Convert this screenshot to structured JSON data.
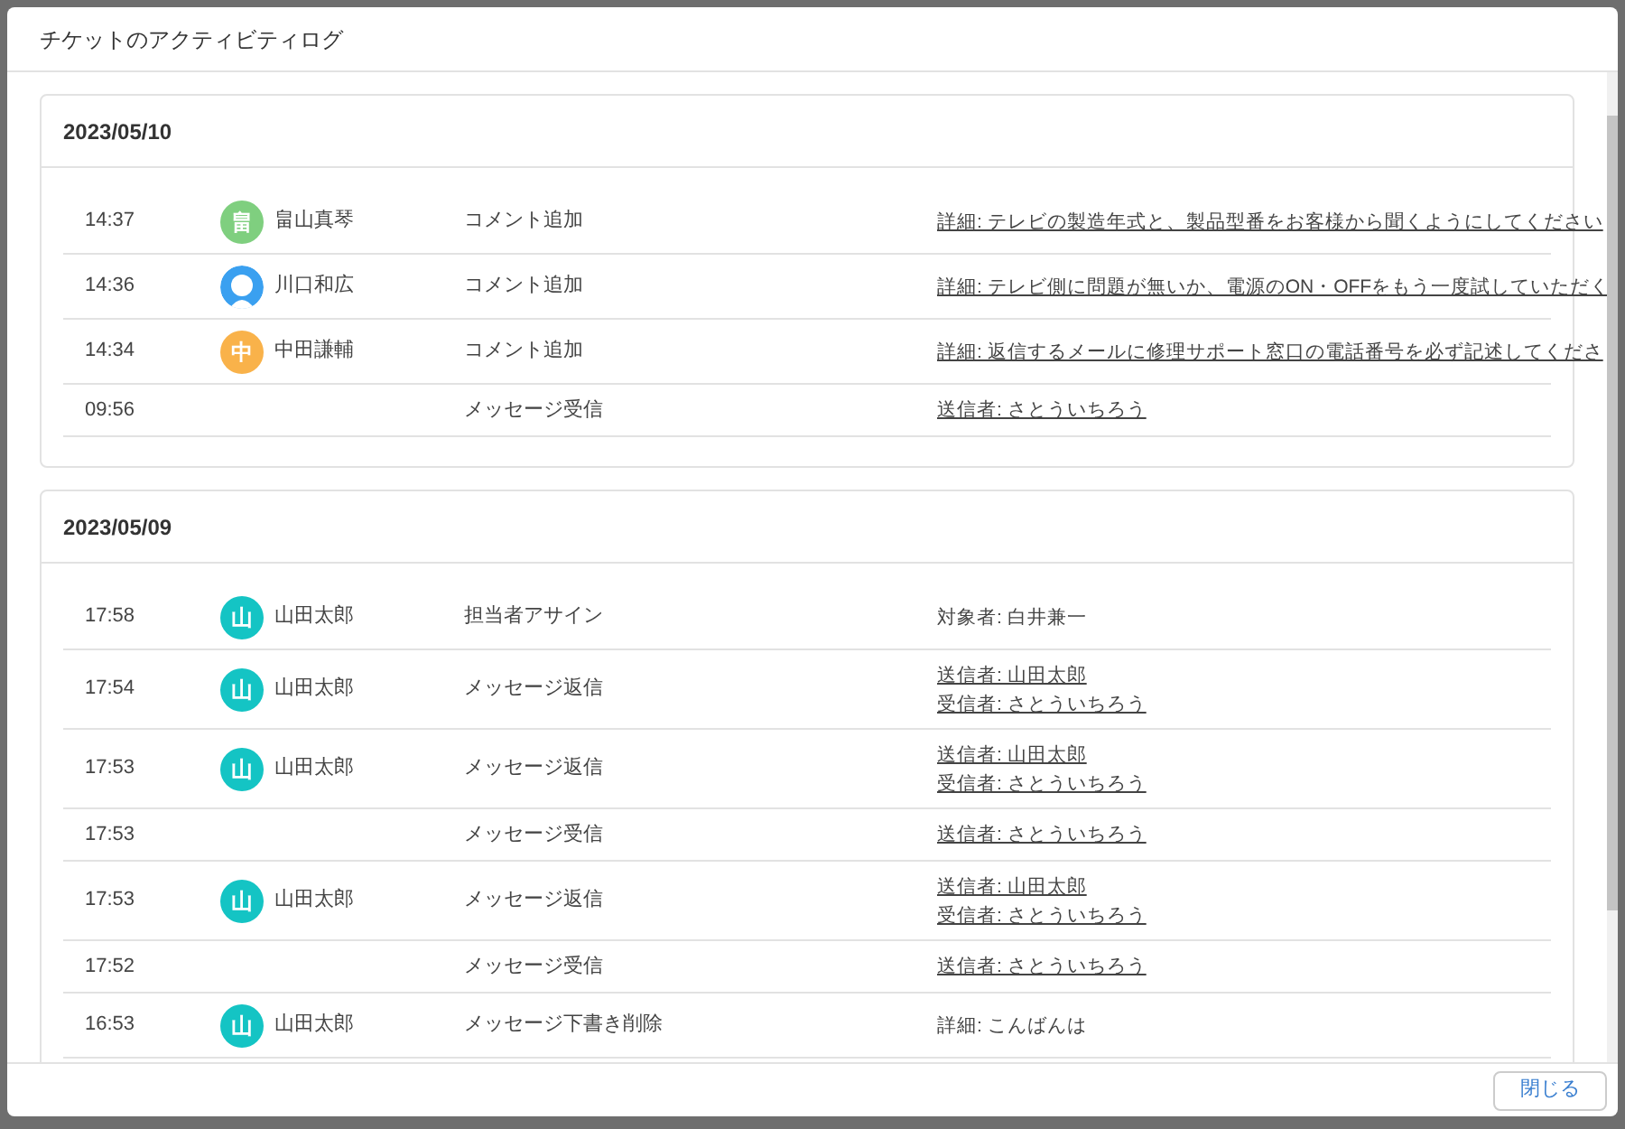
{
  "dialog": {
    "title": "チケットのアクティビティログ"
  },
  "days": [
    {
      "date": "2023/05/10",
      "entries": [
        {
          "time": "14:37",
          "avatar": {
            "kind": "initial",
            "initial": "畠",
            "color": "#7fcf7f"
          },
          "user": "畠山真琴",
          "action": "コメント追加",
          "details": [
            {
              "text": "詳細: テレビの製造年式と、製品型番をお客様から聞くようにしてください",
              "link": true
            }
          ]
        },
        {
          "time": "14:36",
          "avatar": {
            "kind": "person",
            "color": "#3aa0f0"
          },
          "user": "川口和広",
          "action": "コメント追加",
          "details": [
            {
              "text": "詳細: テレビ側に問題が無いか、電源のON・OFFをもう一度試していただく",
              "link": true
            }
          ]
        },
        {
          "time": "14:34",
          "avatar": {
            "kind": "initial",
            "initial": "中",
            "color": "#f9b24a"
          },
          "user": "中田謙輔",
          "action": "コメント追加",
          "details": [
            {
              "text": "詳細: 返信するメールに修理サポート窓口の電話番号を必ず記述してくださ",
              "link": true
            }
          ]
        },
        {
          "time": "09:56",
          "action": "メッセージ受信",
          "details": [
            {
              "text": "送信者: さとういちろう",
              "link": true
            }
          ]
        }
      ]
    },
    {
      "date": "2023/05/09",
      "entries": [
        {
          "time": "17:58",
          "avatar": {
            "kind": "initial",
            "initial": "山",
            "color": "#14c4c4"
          },
          "user": "山田太郎",
          "action": "担当者アサイン",
          "details": [
            {
              "text": "対象者: 白井兼一",
              "link": false
            }
          ]
        },
        {
          "time": "17:54",
          "avatar": {
            "kind": "initial",
            "initial": "山",
            "color": "#14c4c4"
          },
          "user": "山田太郎",
          "action": "メッセージ返信",
          "details": [
            {
              "text": "送信者: 山田太郎",
              "link": true
            },
            {
              "text": "受信者: さとういちろう",
              "link": true
            }
          ]
        },
        {
          "time": "17:53",
          "avatar": {
            "kind": "initial",
            "initial": "山",
            "color": "#14c4c4"
          },
          "user": "山田太郎",
          "action": "メッセージ返信",
          "details": [
            {
              "text": "送信者: 山田太郎",
              "link": true
            },
            {
              "text": "受信者: さとういちろう",
              "link": true
            }
          ]
        },
        {
          "time": "17:53",
          "action": "メッセージ受信",
          "details": [
            {
              "text": "送信者: さとういちろう",
              "link": true
            }
          ]
        },
        {
          "time": "17:53",
          "avatar": {
            "kind": "initial",
            "initial": "山",
            "color": "#14c4c4"
          },
          "user": "山田太郎",
          "action": "メッセージ返信",
          "details": [
            {
              "text": "送信者: 山田太郎",
              "link": true
            },
            {
              "text": "受信者: さとういちろう",
              "link": true
            }
          ]
        },
        {
          "time": "17:52",
          "action": "メッセージ受信",
          "details": [
            {
              "text": "送信者: さとういちろう",
              "link": true
            }
          ]
        },
        {
          "time": "16:53",
          "avatar": {
            "kind": "initial",
            "initial": "山",
            "color": "#14c4c4"
          },
          "user": "山田太郎",
          "action": "メッセージ下書き削除",
          "details": [
            {
              "text": "詳細: こんばんは",
              "link": false
            }
          ]
        }
      ]
    }
  ],
  "close_button": "閉じる"
}
